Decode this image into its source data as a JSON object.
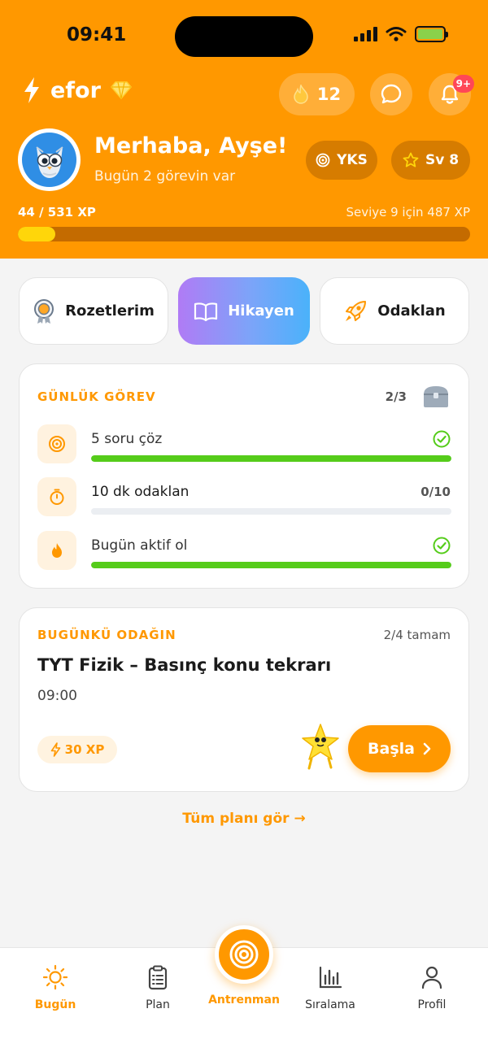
{
  "status_bar": {
    "time": "09:41"
  },
  "header": {
    "brand": "efor",
    "streak_count": "12",
    "notification_badge": "9+",
    "greeting": "Merhaba, Ayşe!",
    "subtitle": "Bugün 2 görevin var",
    "exam_chip": "YKS",
    "level_chip": "Sv 8",
    "xp_text": "44 / 531 XP",
    "xp_next": "Seviye 9 için 487 XP",
    "xp_progress": 0.083
  },
  "quick_actions": [
    {
      "label": "Rozetlerim",
      "icon": "medal-icon"
    },
    {
      "label": "Hikayen",
      "icon": "book-icon"
    },
    {
      "label": "Odaklan",
      "icon": "rocket-icon"
    }
  ],
  "daily_tasks": {
    "title": "GÜNLÜK GÖREV",
    "count": "2/3",
    "items": [
      {
        "label": "5 soru çöz",
        "icon": "target-icon",
        "progress": 1.0,
        "status": "done"
      },
      {
        "label": "10 dk odaklan",
        "icon": "timer-icon",
        "progress": 0.0,
        "status": "0/10"
      },
      {
        "label": "Bugün aktif ol",
        "icon": "flame-icon",
        "progress": 1.0,
        "status": "done"
      }
    ]
  },
  "focus": {
    "title": "BUGÜNKÜ ODAĞIN",
    "status": "2/4 tamam",
    "subject": "TYT Fizik – Basınç konu tekrarı",
    "time": "09:00",
    "xp": "30 XP",
    "start_label": "Başla"
  },
  "see_plan": "Tüm planı gör →",
  "bottom_nav": [
    {
      "label": "Bugün",
      "icon": "sun-icon",
      "active": true
    },
    {
      "label": "Plan",
      "icon": "clipboard-icon",
      "active": false
    },
    {
      "label": "Antrenman",
      "icon": "target-icon",
      "active": true
    },
    {
      "label": "Sıralama",
      "icon": "bar-chart-icon",
      "active": false
    },
    {
      "label": "Profil",
      "icon": "person-icon",
      "active": false
    }
  ],
  "colors": {
    "brand": "#ff9800",
    "success": "#55cc1a",
    "xp_fill": "#ffd60a"
  }
}
